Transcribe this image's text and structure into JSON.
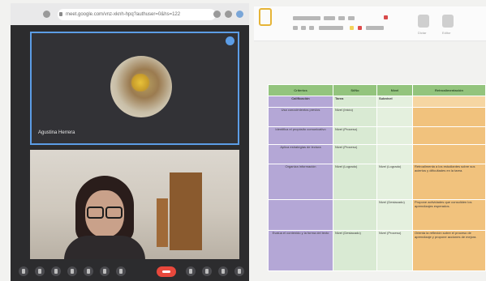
{
  "meet": {
    "url": "meet.google.com/vnz-xknh-hpq?authuser=0&hs=122",
    "remote_participant": "Agustina Herrera",
    "controls": [
      "mic",
      "camera",
      "captions",
      "hand",
      "present",
      "more",
      "end-call",
      "info",
      "people",
      "chat",
      "activities"
    ]
  },
  "colors": {
    "table_header": "#93c47d",
    "col1": "#b4a7d6",
    "col2": "#d9ead3",
    "col4": "#f1c27d",
    "end_call": "#e8483c"
  },
  "doc": {
    "toolbar_labels": [
      "Dictar",
      "Editor"
    ],
    "table": {
      "headers": [
        "Criterios",
        "Sí/No",
        "Nivel",
        "Retroalimentación"
      ],
      "rows": [
        [
          "Calificación",
          "Tarea",
          "Subnivel",
          ""
        ],
        [
          "Usa conocimientos previos",
          "Nivel (Inicio)",
          "",
          ""
        ],
        [
          "Identifica el propósito comunicativo",
          "Nivel (Proceso)",
          "",
          ""
        ],
        [
          "Aplica estrategias de lectura",
          "Nivel (Proceso)",
          "",
          ""
        ],
        [
          "Organiza información",
          "Nivel (Logrado)",
          "Nivel (Logrado)",
          "Retroalimenta a los estudiantes sobre sus aciertos y dificultades en la tarea."
        ],
        [
          "",
          "",
          "Nivel (Destacado)",
          "Propone actividades que consoliden los aprendizajes esperados."
        ],
        [
          "Evalúa el contenido y la forma del texto",
          "Nivel (Destacado)",
          "Nivel (Proceso)",
          "Orienta la reflexión sobre el proceso de aprendizaje y propone acciones de mejora."
        ]
      ]
    }
  }
}
